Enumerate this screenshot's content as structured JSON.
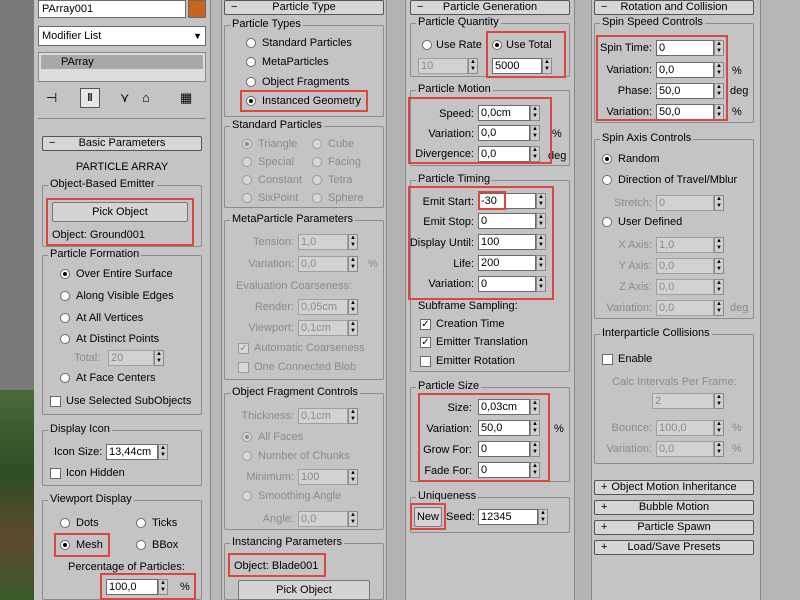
{
  "left": {
    "object_name": "PArray001",
    "modifier_list": "Modifier List",
    "stack_item": "PArray",
    "toolbar_icons": [
      "pin-stack-icon",
      "show-end-result-icon",
      "make-unique-icon",
      "remove-modifier-icon",
      "configure-modifier-sets-icon"
    ],
    "basic_params": {
      "rollout": "Basic Parameters",
      "heading": "PARTICLE ARRAY",
      "emitter": {
        "title": "Object-Based Emitter",
        "pick_label": "Pick Object",
        "object_label": "Object: Ground001"
      },
      "formation": {
        "title": "Particle Formation",
        "options": [
          "Over Entire Surface",
          "Along Visible Edges",
          "At All Vertices",
          "At Distinct Points",
          "At Face Centers"
        ],
        "total_label": "Total:",
        "total_value": "20",
        "subobjects_label": "Use Selected SubObjects"
      },
      "display_icon": {
        "title": "Display Icon",
        "size_label": "Icon Size:",
        "size_value": "13,44cm",
        "hidden_label": "Icon Hidden"
      },
      "viewport": {
        "title": "Viewport Display",
        "options": [
          "Dots",
          "Ticks",
          "Mesh",
          "BBox"
        ],
        "pct_label": "Percentage of Particles:",
        "pct_value": "100,0",
        "pct_unit": "%"
      }
    }
  },
  "col2": {
    "rollout": "Particle Type",
    "types": {
      "title": "Particle Types",
      "options": [
        "Standard Particles",
        "MetaParticles",
        "Object Fragments",
        "Instanced Geometry"
      ]
    },
    "standard": {
      "title": "Standard Particles",
      "options": [
        "Triangle",
        "Cube",
        "Special",
        "Facing",
        "Constant",
        "Tetra",
        "SixPoint",
        "Sphere"
      ]
    },
    "meta": {
      "title": "MetaParticle Parameters",
      "tension_label": "Tension:",
      "tension_value": "1,0",
      "variation_label": "Variation:",
      "variation_value": "0,0",
      "variation_unit": "%",
      "coarse_title": "Evaluation Coarseness:",
      "render_label": "Render:",
      "render_value": "0,05cm",
      "viewport_label": "Viewport:",
      "viewport_value": "0,1cm",
      "auto_label": "Automatic Coarseness",
      "blob_label": "One Connected Blob"
    },
    "fragment": {
      "title": "Object Fragment Controls",
      "thickness_label": "Thickness:",
      "thickness_value": "0,1cm",
      "options": [
        "All Faces",
        "Number of Chunks",
        "Smoothing Angle"
      ],
      "minimum_label": "Minimum:",
      "minimum_value": "100",
      "angle_label": "Angle:",
      "angle_value": "0,0"
    },
    "instancing": {
      "title": "Instancing Parameters",
      "object_label": "Object: Blade001",
      "pick_label": "Pick Object"
    }
  },
  "col3": {
    "rollout": "Particle Generation",
    "quantity": {
      "title": "Particle Quantity",
      "use_rate": "Use Rate",
      "use_total": "Use Total",
      "rate_value": "10",
      "total_value": "5000"
    },
    "motion": {
      "title": "Particle Motion",
      "speed_label": "Speed:",
      "speed_value": "0,0cm",
      "variation_label": "Variation:",
      "variation_value": "0,0",
      "variation_unit": "%",
      "divergence_label": "Divergence:",
      "divergence_value": "0,0",
      "divergence_unit": "deg"
    },
    "timing": {
      "title": "Particle Timing",
      "emit_start_label": "Emit Start:",
      "emit_start_value": "-30",
      "emit_stop_label": "Emit Stop:",
      "emit_stop_value": "0",
      "display_until_label": "Display Until:",
      "display_until_value": "100",
      "life_label": "Life:",
      "life_value": "200",
      "variation_label": "Variation:",
      "variation_value": "0",
      "subframe_label": "Subframe Sampling:",
      "creation_time": "Creation Time",
      "emitter_translation": "Emitter Translation",
      "emitter_rotation": "Emitter Rotation"
    },
    "size": {
      "title": "Particle Size",
      "size_label": "Size:",
      "size_value": "0,03cm",
      "variation_label": "Variation:",
      "variation_value": "50,0",
      "variation_unit": "%",
      "grow_label": "Grow For:",
      "grow_value": "0",
      "fade_label": "Fade For:",
      "fade_value": "0"
    },
    "uniqueness": {
      "title": "Uniqueness",
      "new_label": "New",
      "seed_label": "Seed:",
      "seed_value": "12345"
    }
  },
  "col4": {
    "rollout": "Rotation and Collision",
    "spin_speed": {
      "title": "Spin Speed Controls",
      "spin_time_label": "Spin Time:",
      "spin_time_value": "0",
      "var1_label": "Variation:",
      "var1_value": "0,0",
      "var1_unit": "%",
      "phase_label": "Phase:",
      "phase_value": "50,0",
      "phase_unit": "deg",
      "var2_label": "Variation:",
      "var2_value": "50,0",
      "var2_unit": "%"
    },
    "spin_axis": {
      "title": "Spin Axis Controls",
      "random": "Random",
      "direction": "Direction of Travel/Mblur",
      "stretch_label": "Stretch:",
      "stretch_value": "0",
      "user_defined": "User Defined",
      "x_label": "X Axis:",
      "x_value": "1,0",
      "y_label": "Y Axis:",
      "y_value": "0,0",
      "z_label": "Z Axis:",
      "z_value": "0,0",
      "var_label": "Variation:",
      "var_value": "0,0",
      "var_unit": "deg"
    },
    "collisions": {
      "title": "Interparticle Collisions",
      "enable": "Enable",
      "calc_label": "Calc Intervals Per Frame:",
      "calc_value": "2",
      "bounce_label": "Bounce:",
      "bounce_value": "100,0",
      "bounce_unit": "%",
      "var_label": "Variation:",
      "var_value": "0,0",
      "var_unit": "%"
    },
    "collapsed": [
      "Object Motion Inheritance",
      "Bubble Motion",
      "Particle Spawn",
      "Load/Save Presets"
    ]
  },
  "colors": {
    "highlight": "#d9473f",
    "panel": "#c4c4c4",
    "object_color": "#c8641e"
  }
}
